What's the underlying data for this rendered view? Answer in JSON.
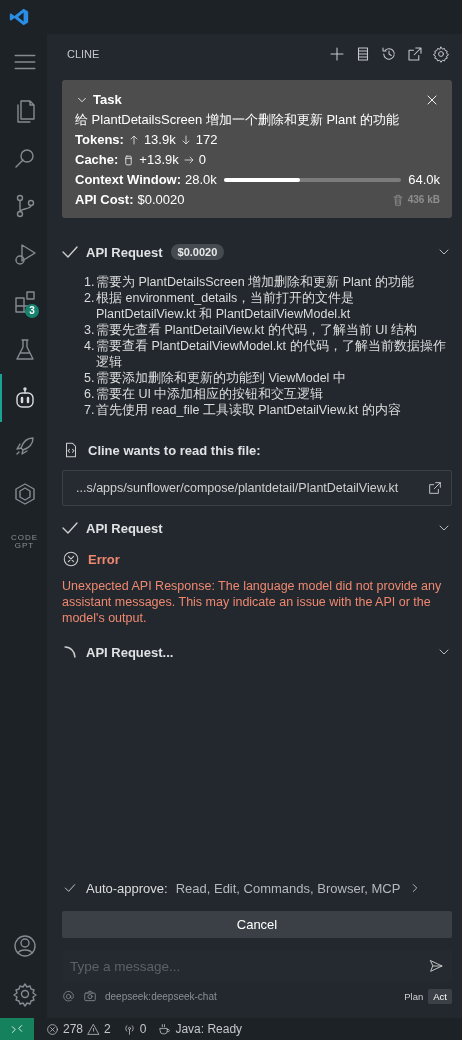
{
  "activity_bar": {
    "items": [
      {
        "kind": "files",
        "selected": false
      },
      {
        "kind": "search",
        "selected": false
      },
      {
        "kind": "source-control",
        "selected": false
      },
      {
        "kind": "debug",
        "selected": false
      },
      {
        "kind": "extensions",
        "selected": false,
        "badge": "3"
      },
      {
        "kind": "flask",
        "selected": false
      },
      {
        "kind": "robot",
        "selected": true
      },
      {
        "kind": "rocket",
        "selected": false
      },
      {
        "kind": "hexagon",
        "selected": false
      },
      {
        "kind": "text-logo",
        "selected": false,
        "text": "CODE GPT"
      }
    ],
    "bottom": [
      {
        "kind": "account"
      },
      {
        "kind": "settings"
      }
    ]
  },
  "panel": {
    "title": "CLINE",
    "actions": [
      {
        "kind": "plus"
      },
      {
        "kind": "list"
      },
      {
        "kind": "history"
      },
      {
        "kind": "popout"
      },
      {
        "kind": "settings"
      }
    ]
  },
  "task": {
    "label": "Task",
    "expanded": true,
    "description": "给 PlantDetailsScreen 增加一个删除和更新 Plant 的功能",
    "tokens": {
      "label": "Tokens:",
      "up": "13.9k",
      "down": "172"
    },
    "cache": {
      "label": "Cache:",
      "write": "+13.9k",
      "read": "0"
    },
    "context": {
      "label": "Context Window:",
      "used": "28.0k",
      "level": 0.43,
      "max": "64.0k"
    },
    "cost": {
      "label": "API Cost:",
      "value": "$0.0020"
    },
    "size": "436 kB"
  },
  "messages": [
    {
      "kind": "request",
      "loading": false,
      "title": "API Request",
      "cost": "$0.0020"
    },
    {
      "kind": "list",
      "items": [
        {
          "number": "1.",
          "text": "需要为 PlantDetailsScreen 增加删除和更新 Plant 的功能"
        },
        {
          "number": "2.",
          "text": "根据 environment_details，当前打开的文件是 PlantDetailView.kt 和 PlantDetailViewModel.kt"
        },
        {
          "number": "3.",
          "text": "需要先查看 PlantDetailView.kt 的代码，了解当前 UI 结构"
        },
        {
          "number": "4.",
          "text": "需要查看 PlantDetailViewModel.kt 的代码，了解当前数据操作逻辑"
        },
        {
          "number": "5.",
          "text": "需要添加删除和更新的功能到 ViewModel 中"
        },
        {
          "number": "6.",
          "text": "需要在 UI 中添加相应的按钮和交互逻辑"
        },
        {
          "number": "7.",
          "text": "首先使用 read_file 工具读取 PlantDetailView.kt 的内容"
        }
      ]
    },
    {
      "kind": "tool",
      "title": "Cline wants to read this file:",
      "path": "...s/apps/sunflower/compose/plantdetail/PlantDetailView.kt"
    },
    {
      "kind": "request",
      "loading": false,
      "title": "API Request"
    },
    {
      "kind": "error",
      "title": "Error",
      "text": "Unexpected API Response: The language model did not provide any assistant messages. This may indicate an issue with the API or the model's output."
    },
    {
      "kind": "request",
      "loading": true,
      "title": "API Request..."
    }
  ],
  "auto_approve": {
    "checked": true,
    "label": "Auto-approve:",
    "value": "Read, Edit, Commands, Browser, MCP"
  },
  "cancel_button": "Cancel",
  "input": {
    "placeholder": "Type a message..."
  },
  "footer": {
    "model": "deepseek:deepseek-chat",
    "modes": [
      {
        "label": "Plan",
        "selected": false
      },
      {
        "label": "Act",
        "selected": true
      }
    ]
  },
  "status_bar": {
    "errors": "278",
    "warnings": "2",
    "ports": "0",
    "java": "Java: Ready"
  }
}
